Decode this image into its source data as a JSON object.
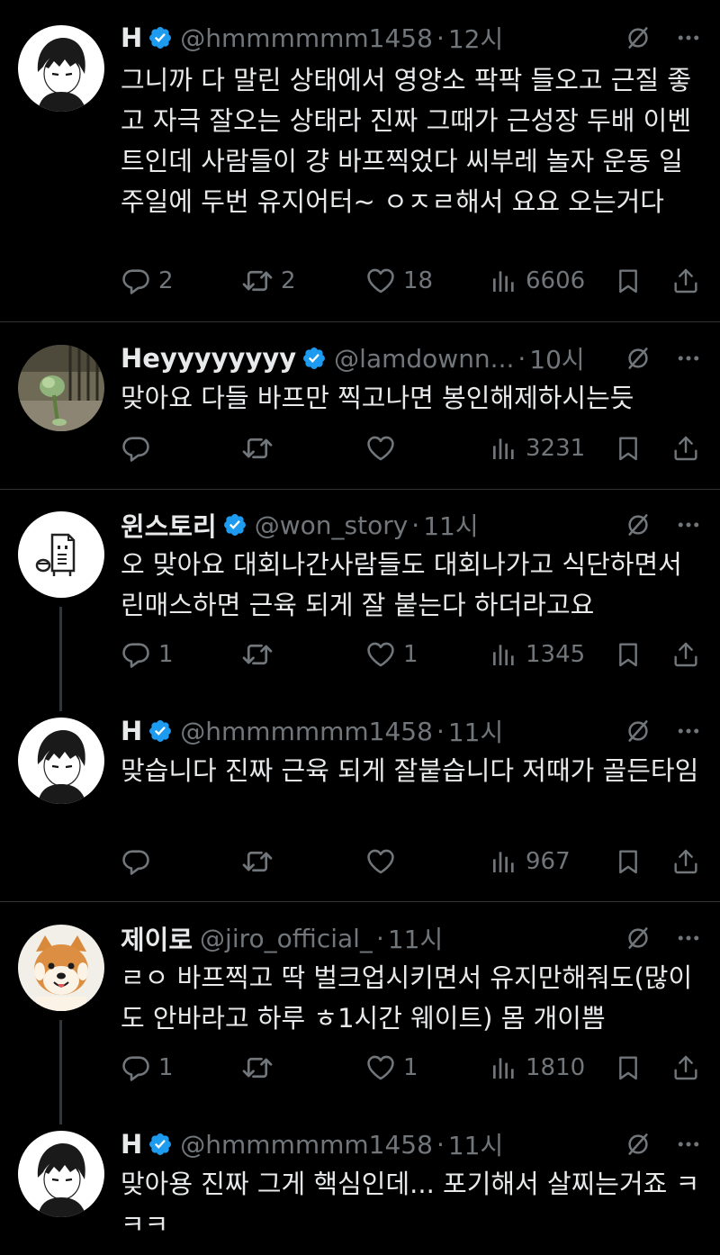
{
  "colors": {
    "background": "#000000",
    "text": "#e7e9ea",
    "muted": "#71767b",
    "verified": "#1d9bf0",
    "divider": "#2f3336"
  },
  "tweets": [
    {
      "name": "H",
      "handle": "@hmmmmmm1458",
      "time": "12시",
      "text": "그니까 다 말린 상태에서 영양소 팍팍 들오고 근질 좋고 자극 잘오는 상태라 진짜 그때가 근성장 두배 이벤트인데 사람들이 걍 바프찍었다 씨부레 놀자 운동 일주일에 두번 유지어터~ ㅇㅈㄹ해서 요요 오는거다",
      "replies": "2",
      "retweets": "2",
      "likes": "18",
      "views": "6606"
    },
    {
      "name": "Heyyyyyyyy",
      "handle": "@lamdownn...",
      "time": "10시",
      "text": "맞아요 다들 바프만 찍고나면 봉인해제하시는듯",
      "replies": "",
      "retweets": "",
      "likes": "",
      "views": "3231"
    },
    {
      "name": "윈스토리",
      "handle": "@won_story",
      "time": "11시",
      "text": "오 맞아요 대회나간사람들도 대회나가고 식단하면서 린매스하면 근육 되게 잘 붙는다 하더라고요",
      "replies": "1",
      "retweets": "",
      "likes": "1",
      "views": "1345"
    },
    {
      "name": "H",
      "handle": "@hmmmmmm1458",
      "time": "11시",
      "text": "맞습니다 진짜 근육 되게 잘붙습니다 저때가 골든타임",
      "replies": "",
      "retweets": "",
      "likes": "",
      "views": "967"
    },
    {
      "name": "제이로",
      "handle": "@jiro_official_",
      "time": "11시",
      "text": "ㄹㅇ 바프찍고 딱 벌크업시키면서 유지만해줘도(많이도 안바라고 하루 ㅎ1시간 웨이트) 몸 개이쁨",
      "replies": "1",
      "retweets": "",
      "likes": "1",
      "views": "1810"
    },
    {
      "name": "H",
      "handle": "@hmmmmmm1458",
      "time": "11시",
      "text": "맞아용 진짜 그게 핵심인데... 포기해서 살찌는거죠 ㅋㅋㅋ"
    }
  ],
  "icons": {
    "verified": "verified-badge-icon",
    "grok": "grok-icon",
    "more": "more-icon",
    "reply": "reply-icon",
    "retweet": "retweet-icon",
    "like": "heart-icon",
    "views": "views-icon",
    "bookmark": "bookmark-icon",
    "share": "share-icon"
  },
  "dot": "·"
}
